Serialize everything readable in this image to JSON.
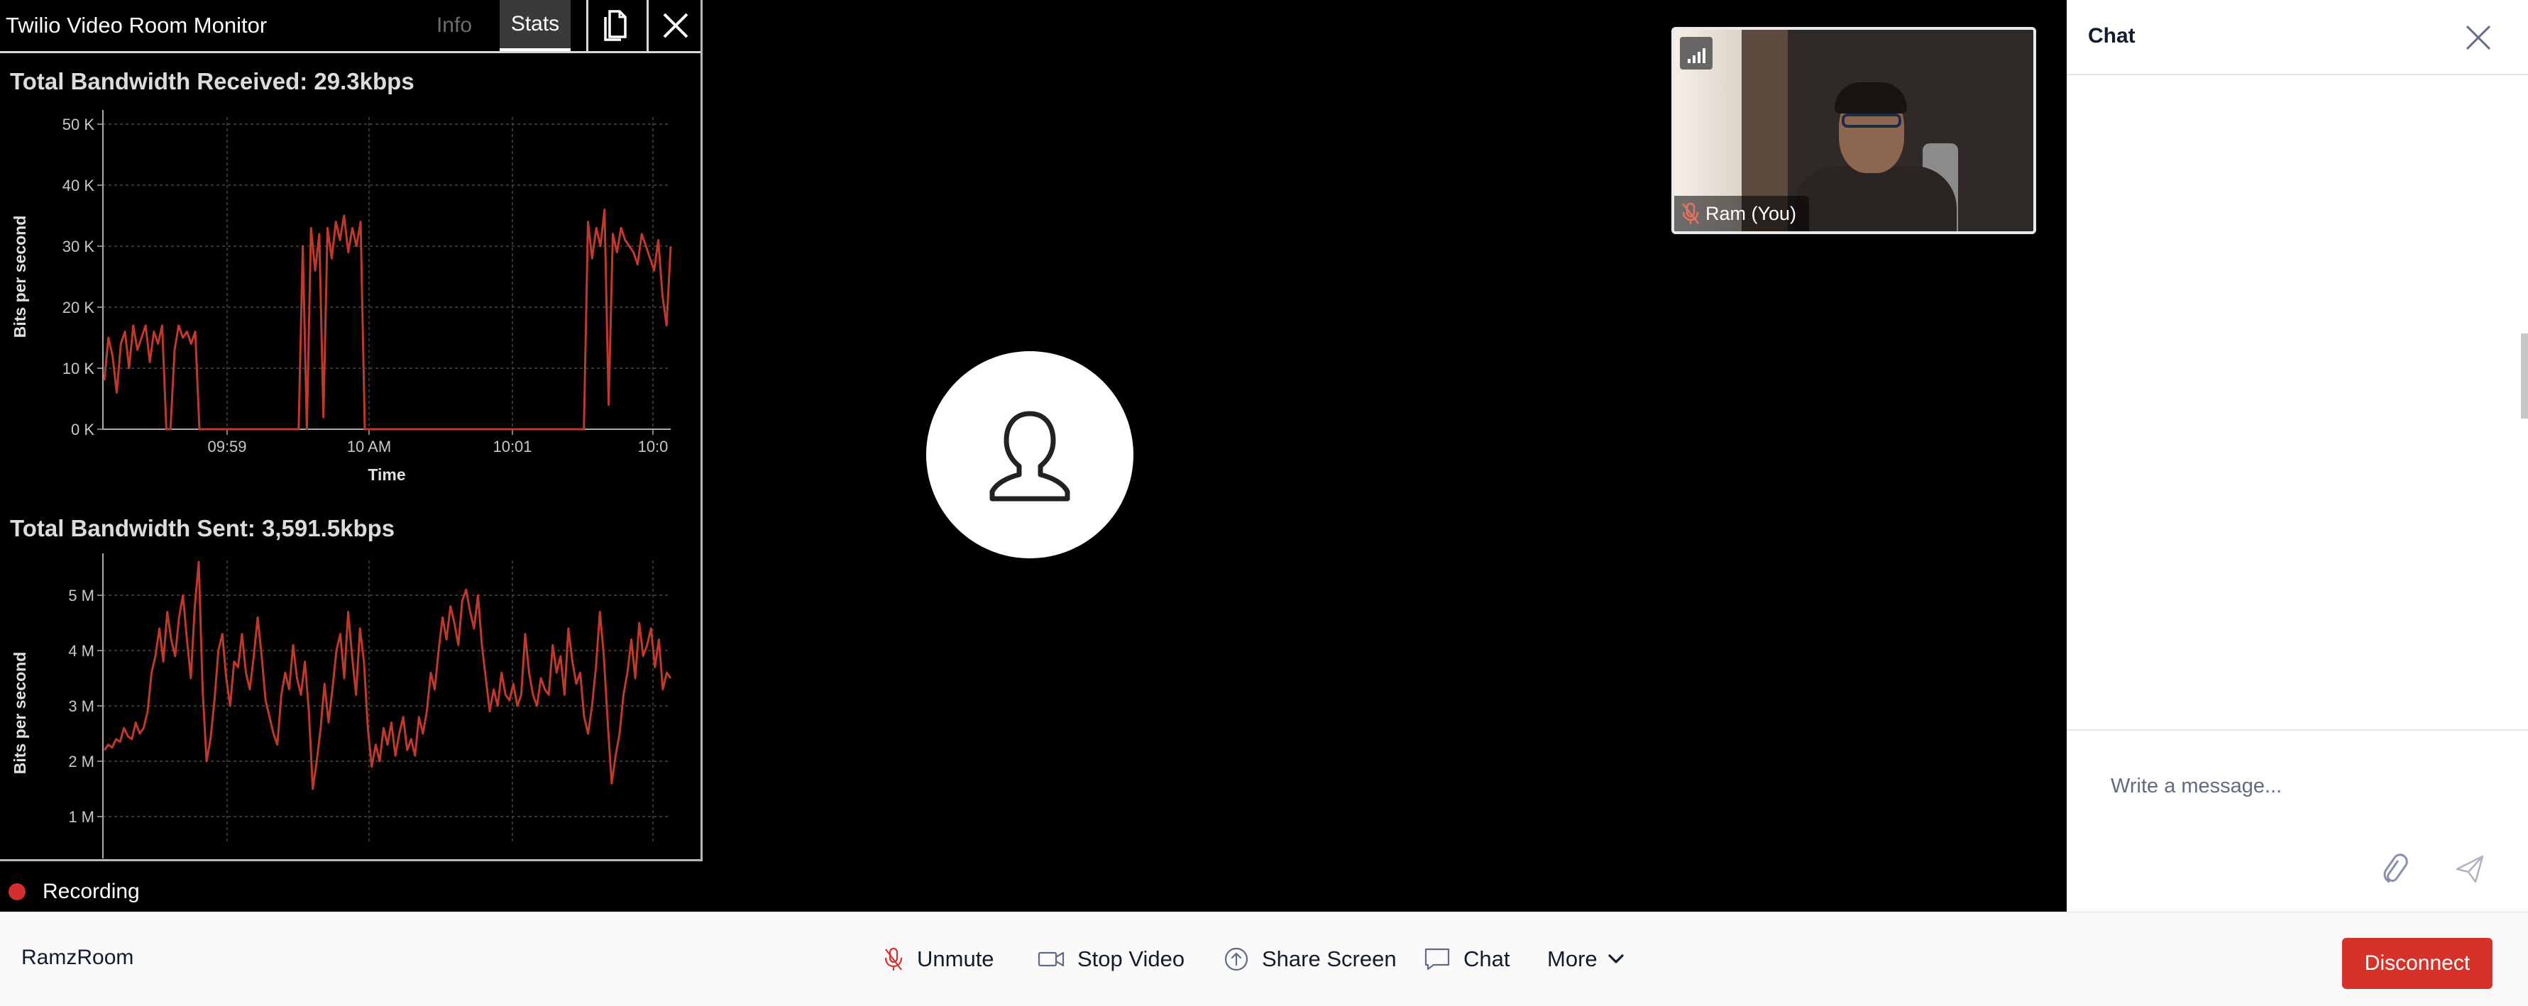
{
  "monitor": {
    "title": "Twilio Video Room Monitor",
    "tabs": [
      {
        "label": "Info",
        "active": false
      },
      {
        "label": "Stats",
        "active": true
      }
    ],
    "charts": [
      {
        "title": "Total Bandwidth Received: 29.3kbps"
      },
      {
        "title": "Total Bandwidth Sent: 3,591.5kbps"
      }
    ]
  },
  "recording": {
    "label": "Recording",
    "color": "#d32f2f"
  },
  "participant": {
    "name": "Ram (You)"
  },
  "chat": {
    "title": "Chat",
    "input_placeholder": "Write a message..."
  },
  "room": {
    "name": "RamzRoom"
  },
  "controls": {
    "unmute": "Unmute",
    "stop_video": "Stop Video",
    "share_screen": "Share Screen",
    "chat": "Chat",
    "more": "More",
    "disconnect": "Disconnect"
  },
  "colors": {
    "series": "#c0392b",
    "disconnect": "#d6322a",
    "accent": "#121c2d"
  },
  "chart_data": [
    {
      "type": "line",
      "title": "Total Bandwidth Received: 29.3kbps",
      "xlabel": "Time",
      "ylabel": "Bits per second",
      "yticks": [
        "0 K",
        "10 K",
        "20 K",
        "30 K",
        "40 K",
        "50 K"
      ],
      "xticks": [
        "09:59",
        "10 AM",
        "10:01",
        "10:0"
      ],
      "ylim": [
        0,
        50000
      ],
      "grid": true,
      "series": [
        {
          "values": [
            8000,
            15000,
            12000,
            6000,
            14000,
            16000,
            10000,
            17000,
            13000,
            15000,
            17000,
            11000,
            16000,
            14000,
            17000,
            0,
            0,
            13000,
            17000,
            15000,
            16000,
            14000,
            16000,
            0,
            0,
            0,
            0,
            0,
            0,
            0,
            0,
            0,
            0,
            0,
            0,
            0,
            0,
            0,
            0,
            0,
            0,
            0,
            0,
            0,
            0,
            0,
            0,
            0,
            30000,
            0,
            33000,
            26000,
            32000,
            2000,
            33000,
            28000,
            34000,
            31000,
            35000,
            29000,
            33000,
            30000,
            34000,
            0,
            0,
            0,
            0,
            0,
            0,
            0,
            0,
            0,
            0,
            0,
            0,
            0,
            0,
            0,
            0,
            0,
            0,
            0,
            0,
            0,
            0,
            0,
            0,
            0,
            0,
            0,
            0,
            0,
            0,
            0,
            0,
            0,
            0,
            0,
            0,
            0,
            0,
            0,
            0,
            0,
            0,
            0,
            0,
            0,
            0,
            0,
            0,
            0,
            0,
            0,
            0,
            0,
            0,
            34000,
            28000,
            33000,
            30000,
            36000,
            4000,
            32000,
            29000,
            33000,
            31000,
            30000,
            29000,
            27000,
            32000,
            30000,
            28000,
            26000,
            31000,
            22000,
            17000,
            30000
          ]
        }
      ]
    },
    {
      "type": "line",
      "title": "Total Bandwidth Sent: 3,591.5kbps",
      "xlabel": "",
      "ylabel": "Bits per second",
      "yticks": [
        "1 M",
        "2 M",
        "3 M",
        "4 M",
        "5 M"
      ],
      "ylim": [
        500000,
        5500000
      ],
      "grid": true,
      "series": [
        {
          "values": [
            2200000,
            2300000,
            2250000,
            2400000,
            2350000,
            2600000,
            2450000,
            2400000,
            2700000,
            2500000,
            2600000,
            2900000,
            3600000,
            3900000,
            4400000,
            3800000,
            4700000,
            4200000,
            3900000,
            4600000,
            5000000,
            4200000,
            3500000,
            4800000,
            5600000,
            3300000,
            2000000,
            2400000,
            3100000,
            4000000,
            4300000,
            3500000,
            3000000,
            3800000,
            3700000,
            4300000,
            3600000,
            3300000,
            3900000,
            4600000,
            3900000,
            3100000,
            2800000,
            2500000,
            2300000,
            3200000,
            3600000,
            3300000,
            4100000,
            3500000,
            3200000,
            3800000,
            2900000,
            1500000,
            2000000,
            2600000,
            3400000,
            2700000,
            3300000,
            4000000,
            4300000,
            3500000,
            4700000,
            3900000,
            3200000,
            4400000,
            3800000,
            2600000,
            1900000,
            2300000,
            2000000,
            2600000,
            2300000,
            2700000,
            2100000,
            2500000,
            2800000,
            2200000,
            2400000,
            2100000,
            2800000,
            2500000,
            2900000,
            3600000,
            3300000,
            4000000,
            4600000,
            4200000,
            4800000,
            4500000,
            4100000,
            4900000,
            5100000,
            4700000,
            4400000,
            5000000,
            4100000,
            3500000,
            2900000,
            3300000,
            3000000,
            3600000,
            3200000,
            3100000,
            3400000,
            3000000,
            3200000,
            4300000,
            3600000,
            3200000,
            3000000,
            3500000,
            3300000,
            3200000,
            4100000,
            3600000,
            3900000,
            3200000,
            4400000,
            3800000,
            3400000,
            3600000,
            2800000,
            2500000,
            3000000,
            3700000,
            4700000,
            3900000,
            2700000,
            1600000,
            2100000,
            2500000,
            3200000,
            3600000,
            4200000,
            3500000,
            4500000,
            3900000,
            4100000,
            4400000,
            3700000,
            4200000,
            3300000,
            3600000,
            3500000
          ]
        }
      ]
    }
  ]
}
